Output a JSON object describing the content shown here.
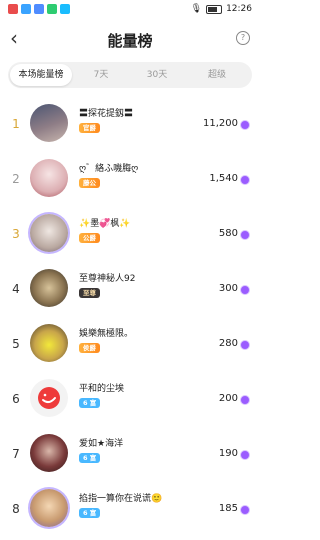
{
  "status_bar": {
    "time": "12:26"
  },
  "header": {
    "title": "能量榜",
    "back_glyph": "‹",
    "help_glyph": "?"
  },
  "tabs": [
    {
      "label": "本场能量榜",
      "active": true
    },
    {
      "label": "7天",
      "active": false
    },
    {
      "label": "30天",
      "active": false
    },
    {
      "label": "超级",
      "active": false
    }
  ],
  "ranking": [
    {
      "rank": "1",
      "name": "〓探花提釼〓",
      "badge": "官爵",
      "value": "11,200"
    },
    {
      "rank": "2",
      "name": "ღ゛絡ふ嘰脢ღ",
      "badge": "藤公",
      "value": "1,540"
    },
    {
      "rank": "3",
      "name": "✨墨💞枫✨",
      "badge": "公爵",
      "value": "580"
    },
    {
      "rank": "4",
      "name": "至尊神秘人92",
      "badge": "至尊",
      "value": "300"
    },
    {
      "rank": "5",
      "name": "娛樂無極限。",
      "badge": "侯爵",
      "value": "280"
    },
    {
      "rank": "6",
      "name": "平和的尘埃",
      "badge": "6 富",
      "value": "200"
    },
    {
      "rank": "7",
      "name": "爱如★海洋",
      "badge": "6 富",
      "value": "190"
    },
    {
      "rank": "8",
      "name": "掐指一算你在说谎🙂",
      "badge": "6 富",
      "value": "185"
    }
  ],
  "colors": {
    "accent_gold": "#d8a635",
    "coin_purple": "#9b5cff",
    "badge_blue": "#49b8ff",
    "badge_orange": "#ff9a2a"
  }
}
